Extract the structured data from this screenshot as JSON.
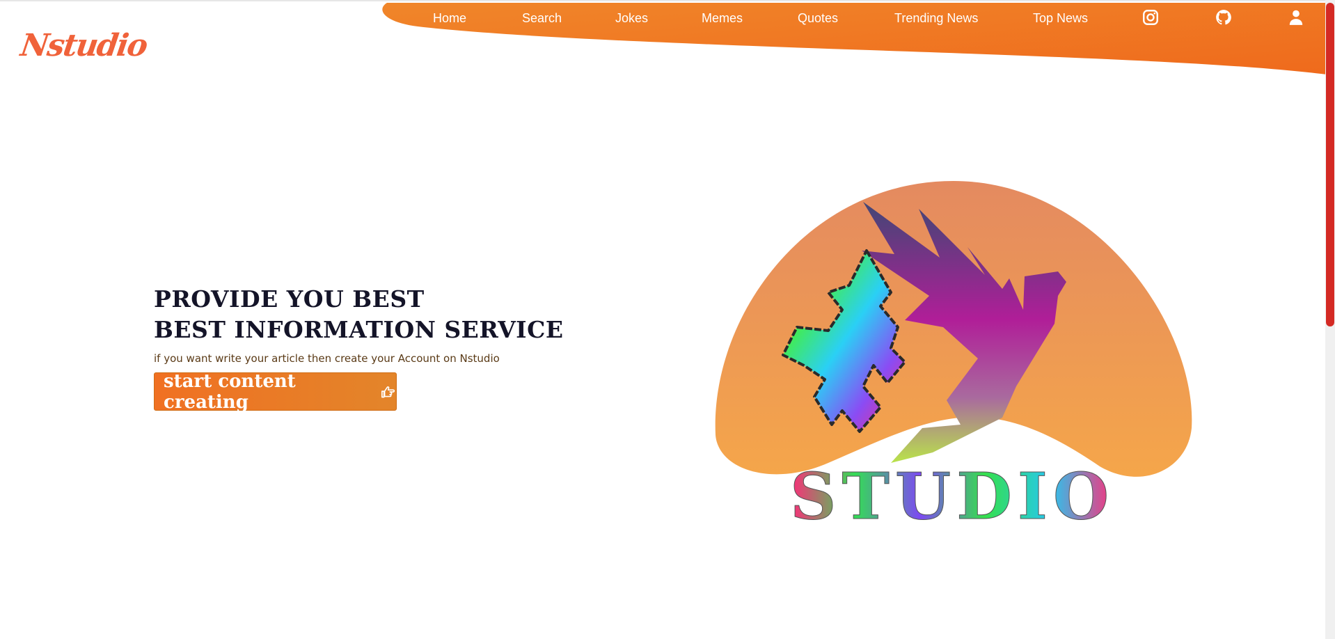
{
  "brand": {
    "logo_text": "Nstudio",
    "accent": "#f07022",
    "accent_light": "#f29a3a"
  },
  "nav": {
    "items": [
      {
        "label": "Home"
      },
      {
        "label": "Search"
      },
      {
        "label": "Jokes"
      },
      {
        "label": "Memes"
      },
      {
        "label": "Quotes"
      },
      {
        "label": "Trending News"
      },
      {
        "label": "Top News"
      }
    ],
    "icons": [
      "instagram-icon",
      "github-icon",
      "user-icon"
    ]
  },
  "hero": {
    "title_line1": "PROVIDE YOU BEST",
    "title_line2": "BEST INFORMATION SERVICE",
    "subtitle": "if you want write your article then create your Account on Nstudio",
    "cta_label": "start content creating",
    "cta_icon": "hand-pointing-right-icon"
  },
  "illustration": {
    "caption": "STUDIO"
  }
}
